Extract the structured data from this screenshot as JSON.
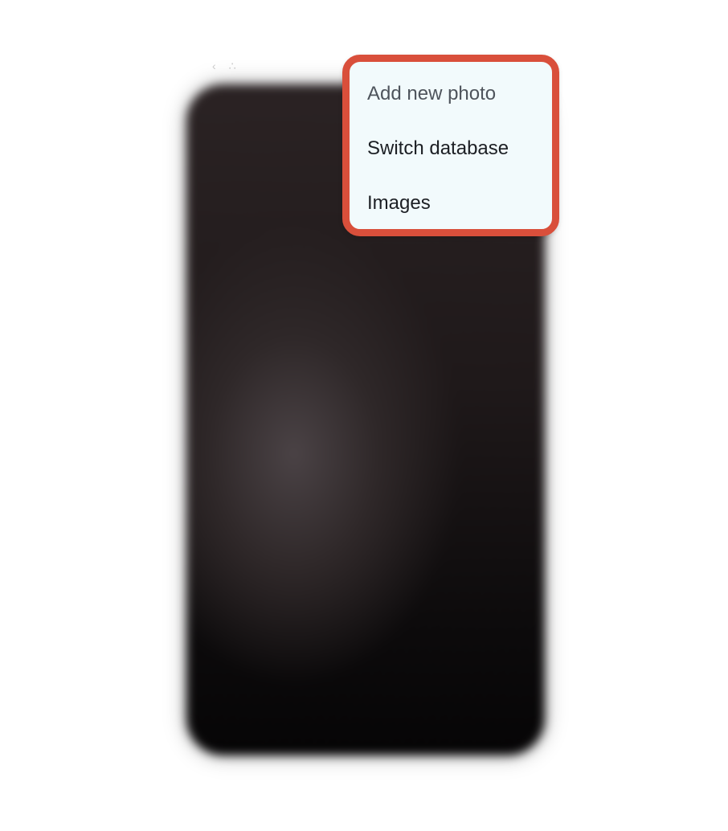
{
  "menu": {
    "items": [
      {
        "label": "Add new photo"
      },
      {
        "label": "Switch database"
      },
      {
        "label": "Images"
      }
    ],
    "highlight_color": "#d94f3b",
    "background_color": "#f2fafc"
  },
  "status_bar": {
    "hint": "‹ ∴"
  }
}
